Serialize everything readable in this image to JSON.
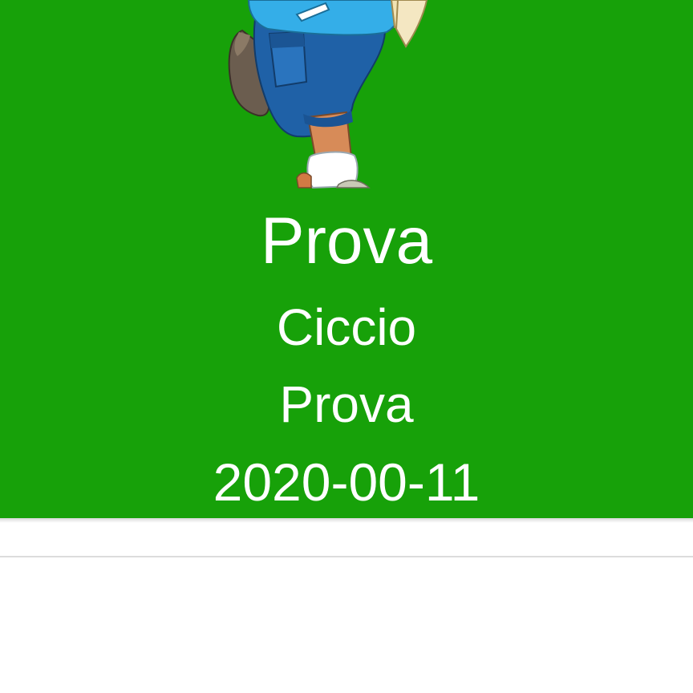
{
  "colors": {
    "card_background": "#17a109",
    "card_text": "#ffffff",
    "page_background": "#ffffff",
    "divider": "#dcdcdc"
  },
  "card": {
    "image_icon": "cartoon-boy-illustration",
    "title": "Prova",
    "author": "Ciccio",
    "subtitle": "Prova",
    "date": "2020-00-11"
  }
}
